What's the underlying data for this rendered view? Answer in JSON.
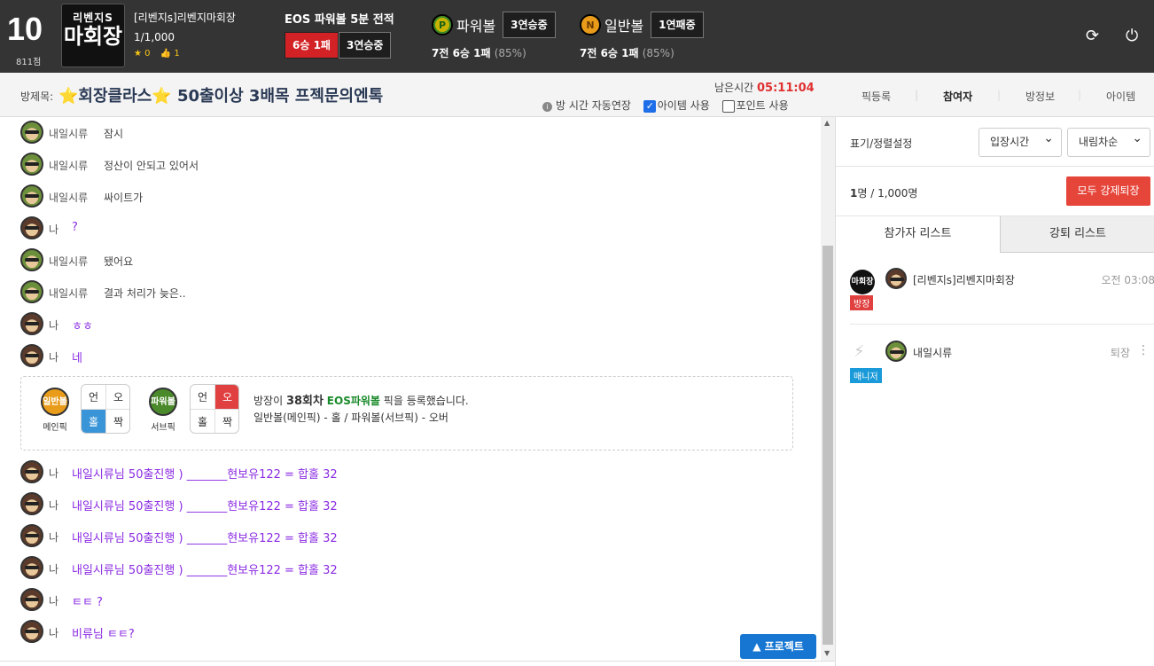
{
  "topbar": {
    "level": "10",
    "points": "811점",
    "logo_line1": "리벤지S",
    "logo_line2": "마회장",
    "username": "[리벤지s]리벤지마회장",
    "count": "1/1,000",
    "stars": "0",
    "likes": "1",
    "eos_title": "EOS 파워볼 5분 전적",
    "eos_record": "6승 1패",
    "eos_streak": "3연승중",
    "powerball": {
      "icon": "P",
      "name": "파워볼",
      "streak": "3연승중",
      "stat": "7전 6승 1패",
      "pct": "(85%)"
    },
    "normalball": {
      "icon": "N",
      "name": "일반볼",
      "streak": "1연패중",
      "stat": "7전 6승 1패",
      "pct": "(85%)"
    },
    "refresh_icon": "⟳",
    "power_icon": "⏻"
  },
  "room": {
    "label": "방제목:",
    "title_star": "⭐",
    "title1": "회장클라스",
    "title2": "50출이상 3배목 프젝문의엔톡",
    "remain_label": "남은시간",
    "remain_time": "05:11:04",
    "auto_extend": "방 시간 자동연장",
    "item_use": "아이템 사용",
    "point_use": "포인트 사용",
    "tabs": [
      "픽등록",
      "참여자",
      "방정보",
      "아이템"
    ]
  },
  "chat": {
    "messages": [
      {
        "who": "내일시류",
        "text": "잠시",
        "me": false
      },
      {
        "who": "내일시류",
        "text": "정산이 안되고 있어서",
        "me": false
      },
      {
        "who": "내일시류",
        "text": "싸이트가",
        "me": false
      },
      {
        "who": "나",
        "text": "?",
        "me": true
      },
      {
        "who": "내일시류",
        "text": "됐어요",
        "me": false
      },
      {
        "who": "내일시류",
        "text": "결과 처리가 늦은..",
        "me": false
      },
      {
        "who": "나",
        "text": "ㅎㅎ",
        "me": true
      },
      {
        "who": "나",
        "text": "네",
        "me": true
      }
    ],
    "pick": {
      "main_icon": "일반볼",
      "main_label": "메인픽",
      "sub_icon": "파워볼",
      "sub_label": "서브픽",
      "grid": [
        "언",
        "오",
        "홀",
        "짝"
      ],
      "msg_pre": "방장이",
      "msg_round": "38회차",
      "msg_game": "EOS파워볼",
      "msg_post": "픽을 등록했습니다.",
      "msg_detail": "일반볼(메인픽) - 홀 / 파워볼(서브픽) - 오버"
    },
    "messages2": [
      {
        "who": "나",
        "text": "내일시류님 50출진행 ) _______현보유122 = 합홀 32"
      },
      {
        "who": "나",
        "text": "내일시류님 50출진행 ) _______현보유122 = 합홀 32"
      },
      {
        "who": "나",
        "text": "내일시류님 50출진행 ) _______현보유122 = 합홀 32"
      },
      {
        "who": "나",
        "text": "내일시류님 50출진행 ) _______현보유122 = 합홀 32"
      },
      {
        "who": "나",
        "text": "ㅌㅌ ?"
      },
      {
        "who": "나",
        "text": "비류님 ㅌㅌ?"
      }
    ],
    "project_button": "▲ 프로젝트"
  },
  "panel": {
    "sort_label": "표기/정렬설정",
    "sort1": "입장시간",
    "sort2": "내림차순",
    "count_bold": "1",
    "count_rest": "명 / 1,000명",
    "kick_all": "모두 강제퇴장",
    "tab_participants": "참가자 리스트",
    "tab_kicked": "강퇴 리스트",
    "participants": [
      {
        "name": "[리벤지s]리벤지마회장",
        "role": "방장",
        "time": "오전 03:08",
        "badge": "마회장"
      },
      {
        "name": "내일시류",
        "role": "매니저",
        "time": "퇴장",
        "badge": ""
      }
    ]
  },
  "colors": {
    "topbar": "#343434",
    "accent_red": "#d32226",
    "my_text": "#8a2be2",
    "project_btn": "#1676d2"
  }
}
